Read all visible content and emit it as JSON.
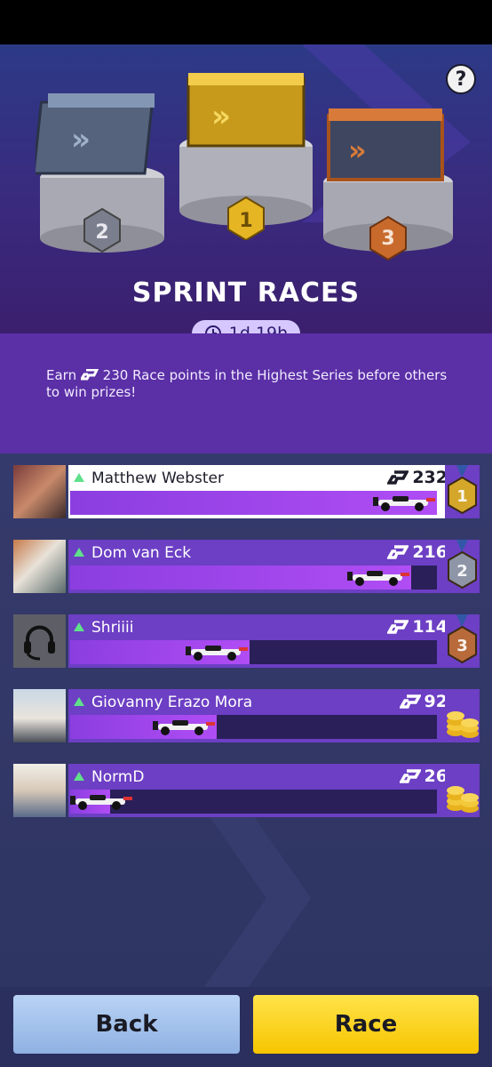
{
  "header": {
    "title": "SPRINT RACES",
    "timer": "1d 19h",
    "help_label": "?"
  },
  "podium": {
    "first": {
      "rank": "1",
      "color": "#f0c22c"
    },
    "second": {
      "rank": "2",
      "color": "#6f86a8"
    },
    "third": {
      "rank": "3",
      "color": "#c86a2c"
    }
  },
  "info": {
    "prefix": "Earn",
    "points": "230",
    "suffix": "Race points in the Highest Series before others to win prizes!"
  },
  "leaderboard": [
    {
      "name": "Matthew Webster",
      "score": "232",
      "progress": 1.0,
      "prize": "1"
    },
    {
      "name": "Dom van Eck",
      "score": "216",
      "progress": 0.93,
      "prize": "2"
    },
    {
      "name": "Shriiii",
      "score": "114",
      "progress": 0.49,
      "prize": "3"
    },
    {
      "name": "Giovanny Erazo Mora",
      "score": "92",
      "progress": 0.4,
      "prize": "coins"
    },
    {
      "name": "NormD",
      "score": "26",
      "progress": 0.11,
      "prize": "coins"
    }
  ],
  "buttons": {
    "back": "Back",
    "race": "Race"
  },
  "colors": {
    "accent_purple": "#6c3fc4",
    "race_yellow": "#f7c500",
    "back_blue": "#a9c4ee",
    "up_green": "#5fe08a"
  }
}
